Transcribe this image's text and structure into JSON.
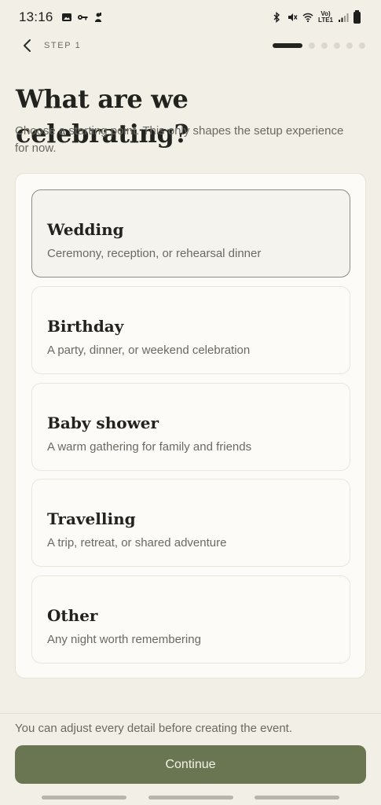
{
  "status_bar": {
    "time": "13:16",
    "network_label_top": "Vo)",
    "network_label_bottom": "LTE1"
  },
  "nav": {
    "step_label": "STEP 1"
  },
  "header": {
    "title": "What are we celebrating?",
    "subtitle": "Choose a starting point. This only shapes the setup experience for now."
  },
  "options": [
    {
      "title": "Wedding",
      "description": "Ceremony, reception, or rehearsal dinner",
      "selected": true
    },
    {
      "title": "Birthday",
      "description": "A party, dinner, or weekend celebration",
      "selected": false
    },
    {
      "title": "Baby shower",
      "description": "A warm gathering for family and friends",
      "selected": false
    },
    {
      "title": "Travelling",
      "description": "A trip, retreat, or shared adventure",
      "selected": false
    },
    {
      "title": "Other",
      "description": "Any night worth remembering",
      "selected": false
    }
  ],
  "footer": {
    "note": "You can adjust every detail before creating the event.",
    "continue_label": "Continue"
  },
  "colors": {
    "background": "#f2efe6",
    "accent": "#6a7551",
    "progress_active": "#23231f"
  }
}
